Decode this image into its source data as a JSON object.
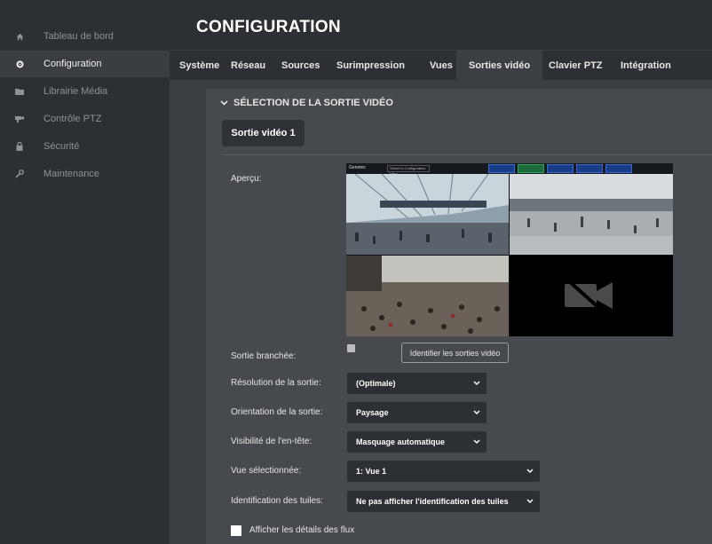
{
  "sidebar": {
    "items": [
      {
        "label": "Tableau de bord",
        "icon": "home-icon"
      },
      {
        "label": "Configuration",
        "icon": "gear-icon",
        "active": true
      },
      {
        "label": "Librairie Média",
        "icon": "folder-icon"
      },
      {
        "label": "Contrôle PTZ",
        "icon": "camera-icon"
      },
      {
        "label": "Sécurité",
        "icon": "lock-icon"
      },
      {
        "label": "Maintenance",
        "icon": "wrench-icon"
      }
    ]
  },
  "header": {
    "title": "CONFIGURATION"
  },
  "tabs": [
    "Système",
    "Réseau",
    "Sources",
    "Surimpression",
    "Vues",
    "Sorties vidéo",
    "Clavier PTZ",
    "Intégration"
  ],
  "active_tab": "Sorties vidéo",
  "panel": {
    "title": "SÉLECTION DE LA SORTIE VIDÉO",
    "output_tab": "Sortie vidéo 1",
    "preview_label": "Aperçu:",
    "preview_bar": {
      "app_name": "Genetec",
      "select_text": "Select to Configuration View"
    },
    "connected_label": "Sortie branchée:",
    "connected_checked": true,
    "identify_button": "Identifier les sorties vidéo",
    "resolution_label": "Résolution de la sortie:",
    "resolution_value": "(Optimale)",
    "orientation_label": "Orientation de la sortie:",
    "orientation_value": "Paysage",
    "header_visibility_label": "Visibilité de l'en-tête:",
    "header_visibility_value": "Masquage automatique",
    "selected_view_label": "Vue sélectionnée:",
    "selected_view_value": "1: Vue 1",
    "tile_id_label": "Identification des tuiles:",
    "tile_id_value": "Ne pas afficher l'identification des tuiles",
    "stream_details_label": "Afficher les détails des flux",
    "stream_details_checked": false
  },
  "colors": {
    "sidebar_bg": "#2c2f33",
    "content_bg": "#3b3e43",
    "panel_bg": "#46494e",
    "select_bg": "#2c2f33",
    "text": "#e6e6e6"
  }
}
